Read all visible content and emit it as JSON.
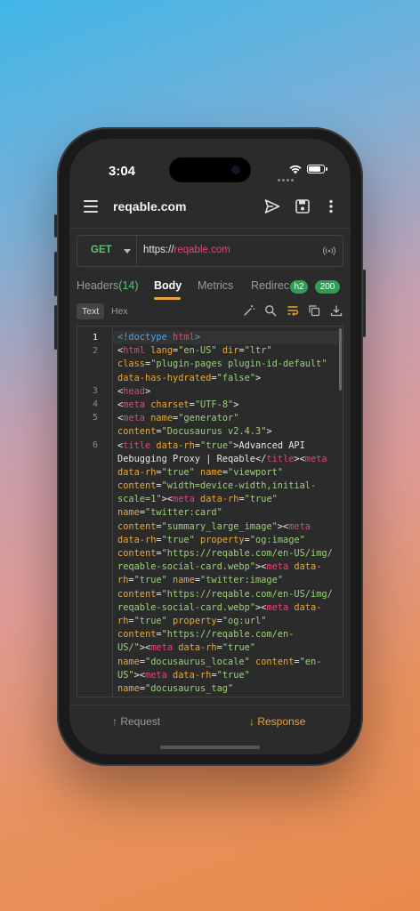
{
  "status_bar": {
    "time": "3:04"
  },
  "app_bar": {
    "title": "reqable.com"
  },
  "request": {
    "method": "GET",
    "url_scheme": "https://",
    "url_host": "reqable.com"
  },
  "tabs": {
    "headers_label": "Headers",
    "headers_count": "(14)",
    "body_label": "Body",
    "metrics_label": "Metrics",
    "redirect_label": "Redirec",
    "protocol_badge": "h2",
    "status_badge": "200"
  },
  "view_mode": {
    "text": "Text",
    "hex": "Hex"
  },
  "editor": {
    "line_numbers": [
      "1",
      "2",
      "3",
      "4",
      "5",
      "6"
    ]
  },
  "bottom_bar": {
    "request_label": "Request",
    "response_label": "Response"
  },
  "colors": {
    "tag": "#e0457a",
    "attribute": "#e9a735",
    "string": "#9bcf7c",
    "accent": "#e9a735",
    "success": "#5bc26e"
  }
}
